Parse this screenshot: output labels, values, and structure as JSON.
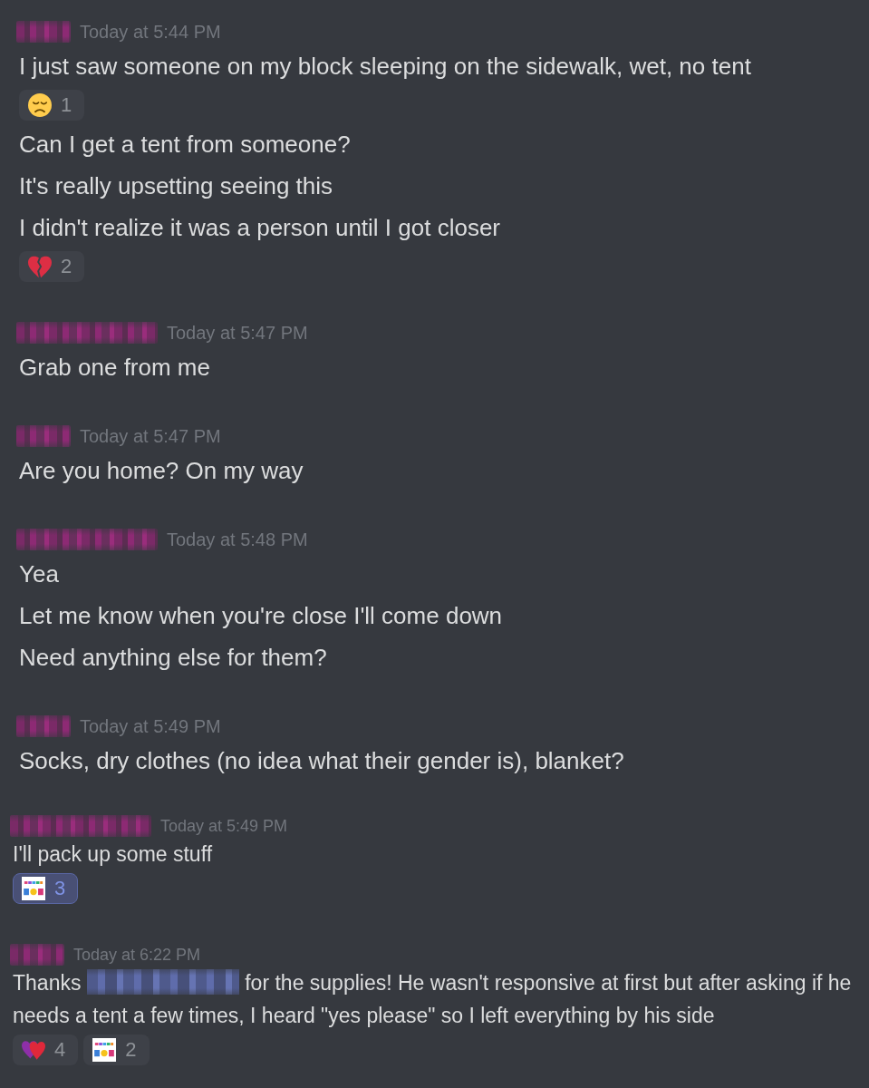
{
  "messages": [
    {
      "kind": "short_name",
      "timestamp": "Today at 5:44 PM",
      "items": [
        {
          "kind": "text",
          "text": "I just saw someone on my block sleeping on the sidewalk, wet, no tent"
        },
        {
          "kind": "reactions",
          "reactions": [
            {
              "kind": "sad-face",
              "count": "1",
              "selected": false
            }
          ]
        },
        {
          "kind": "text",
          "text": "Can I get a tent from someone?"
        },
        {
          "kind": "text",
          "text": "It's really upsetting seeing this"
        },
        {
          "kind": "text",
          "text": "I didn't realize it was a person until I got closer"
        },
        {
          "kind": "reactions",
          "reactions": [
            {
              "kind": "broken-heart",
              "count": "2",
              "selected": false
            }
          ]
        }
      ]
    },
    {
      "kind": "long_name",
      "timestamp": "Today at 5:47 PM",
      "items": [
        {
          "kind": "text",
          "text": "Grab one from me"
        }
      ]
    },
    {
      "kind": "short_name",
      "timestamp": "Today at 5:47 PM",
      "items": [
        {
          "kind": "text",
          "text": "Are you home? On my way"
        }
      ]
    },
    {
      "kind": "long_name",
      "timestamp": "Today at 5:48 PM",
      "items": [
        {
          "kind": "text",
          "text": "Yea"
        },
        {
          "kind": "text",
          "text": "Let me know when you're close I'll come down"
        },
        {
          "kind": "text",
          "text": "Need anything else for them?"
        }
      ]
    },
    {
      "kind": "short_name",
      "timestamp": "Today at 5:49 PM",
      "items": [
        {
          "kind": "text",
          "text": "Socks, dry clothes (no idea what their gender is), blanket?"
        }
      ]
    },
    {
      "kind": "long_name",
      "timestamp": "Today at 5:49 PM",
      "items": [
        {
          "kind": "text",
          "text": "I'll pack up some stuff"
        },
        {
          "kind": "reactions",
          "reactions": [
            {
              "kind": "sticker",
              "count": "3",
              "selected": true
            }
          ]
        }
      ]
    },
    {
      "kind": "short_name",
      "timestamp": "Today at 6:22 PM",
      "items": [
        {
          "kind": "mention_text",
          "before": "Thanks ",
          "after": " for the supplies! He wasn't responsive at first but after asking if he needs a tent a few times, I heard \"yes please\" so I left everything by his side"
        },
        {
          "kind": "reactions",
          "reactions": [
            {
              "kind": "hearts",
              "count": "4",
              "selected": false
            },
            {
              "kind": "sticker",
              "count": "2",
              "selected": false
            }
          ]
        }
      ]
    }
  ]
}
